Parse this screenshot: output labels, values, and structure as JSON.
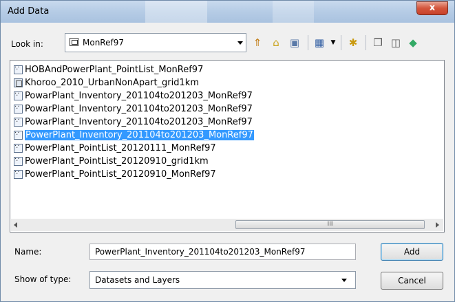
{
  "window": {
    "title": "Add Data",
    "close_glyph": "x"
  },
  "lookin": {
    "label": "Look in:",
    "value": "MonRef97"
  },
  "toolbar": [
    {
      "icon": "up-one-level-icon",
      "glyph": "⇑"
    },
    {
      "icon": "home-icon",
      "glyph": "⌂"
    },
    {
      "icon": "connect-folder-icon",
      "glyph": "▣"
    },
    {
      "icon": "list-view-icon",
      "glyph": "▦"
    },
    {
      "icon": "new-folder-icon",
      "glyph": "✱"
    },
    {
      "icon": "copy-icon",
      "glyph": "❐"
    },
    {
      "icon": "new-shapefile-icon",
      "glyph": "◫"
    },
    {
      "icon": "catalog-icon",
      "glyph": "◆"
    }
  ],
  "files": [
    {
      "name": "HOBAndPowerPlant_PointList_MonRef97",
      "type": "point"
    },
    {
      "name": "Khoroo_2010_UrbanNonApart_grid1km",
      "type": "grid"
    },
    {
      "name": "PowarPlant_Inventory_201104to201203_MonRef97",
      "type": "point"
    },
    {
      "name": "PowarPlant_Inventory_201104to201203_MonRef97",
      "type": "point"
    },
    {
      "name": "PowarPlant_Inventory_201104to201203_MonRef97",
      "type": "point"
    },
    {
      "name": "PowerPlant_Inventory_201104to201203_MonRef97",
      "type": "point",
      "selected": true
    },
    {
      "name": "PowerPlant_PointList_20120111_MonRef97",
      "type": "point"
    },
    {
      "name": "PowerPlant_PointList_20120910_grid1km",
      "type": "point"
    },
    {
      "name": "PowerPlant_PointList_20120910_MonRef97",
      "type": "point"
    }
  ],
  "scrollbar": {
    "thumb_grip": "III"
  },
  "name_field": {
    "label": "Name:",
    "value": "PowerPlant_Inventory_201104to201203_MonRef97"
  },
  "type_field": {
    "label": "Show of type:",
    "value": "Datasets and Layers"
  },
  "buttons": {
    "add": "Add",
    "cancel": "Cancel"
  }
}
